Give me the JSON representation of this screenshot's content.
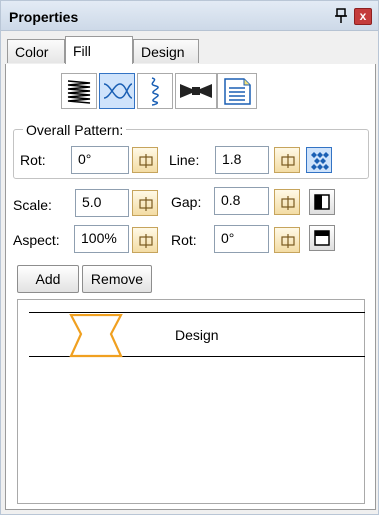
{
  "panel": {
    "title": "Properties",
    "close_glyph": "x"
  },
  "tabs": [
    {
      "label": "Color"
    },
    {
      "label": "Fill"
    },
    {
      "label": "Design"
    }
  ],
  "fill_types": [
    {
      "icon": "zigzag-fill-icon",
      "selected": false
    },
    {
      "icon": "wave-cross-fill-icon",
      "selected": true
    },
    {
      "icon": "motif-line-fill-icon",
      "selected": false
    },
    {
      "icon": "bowtie-fill-icon",
      "selected": false
    },
    {
      "icon": "document-fill-icon",
      "selected": false
    }
  ],
  "overall_pattern": {
    "title": "Overall Pattern:",
    "rot_label": "Rot:",
    "rot_value": "0°",
    "line_label": "Line:",
    "line_value": "1.8"
  },
  "params": {
    "scale_label": "Scale:",
    "scale_value": "5.0",
    "gap_label": "Gap:",
    "gap_value": "0.8",
    "aspect_label": "Aspect:",
    "aspect_value": "100%",
    "rot_label": "Rot:",
    "rot_value": "0°"
  },
  "buttons": {
    "add": "Add",
    "remove": "Remove"
  },
  "design_list": [
    {
      "name": "Design"
    }
  ],
  "colors": {
    "accent": "#f0a020",
    "selection": "#cfe3fb",
    "close": "#c43c3c"
  }
}
